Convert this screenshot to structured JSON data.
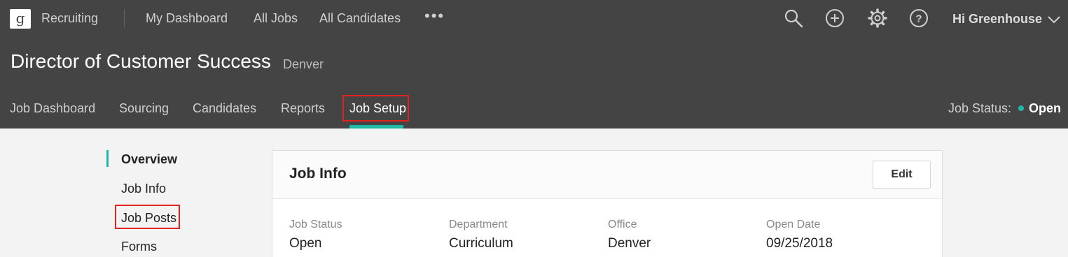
{
  "topbar": {
    "logo": "g",
    "app_name": "Recruiting",
    "nav": [
      "My Dashboard",
      "All Jobs",
      "All Candidates"
    ],
    "more": "•••",
    "greeting": "Hi Greenhouse"
  },
  "job": {
    "title": "Director of Customer Success",
    "location": "Denver"
  },
  "subnav": {
    "tabs": [
      "Job Dashboard",
      "Sourcing",
      "Candidates",
      "Reports",
      "Job Setup"
    ],
    "active": "Job Setup",
    "status_label": "Job Status:",
    "status_value": "Open"
  },
  "sidebar": {
    "items": [
      "Overview",
      "Job Info",
      "Job Posts",
      "Forms"
    ],
    "active": "Overview"
  },
  "card": {
    "title": "Job Info",
    "edit_label": "Edit",
    "fields": [
      {
        "label": "Job Status",
        "value": "Open"
      },
      {
        "label": "Department",
        "value": "Curriculum"
      },
      {
        "label": "Office",
        "value": "Denver"
      },
      {
        "label": "Open Date",
        "value": "09/25/2018"
      }
    ]
  },
  "colors": {
    "header_bg": "#444444",
    "accent": "#1fb8a7",
    "highlight": "#e0231f",
    "page_bg": "#f3f3f3"
  }
}
